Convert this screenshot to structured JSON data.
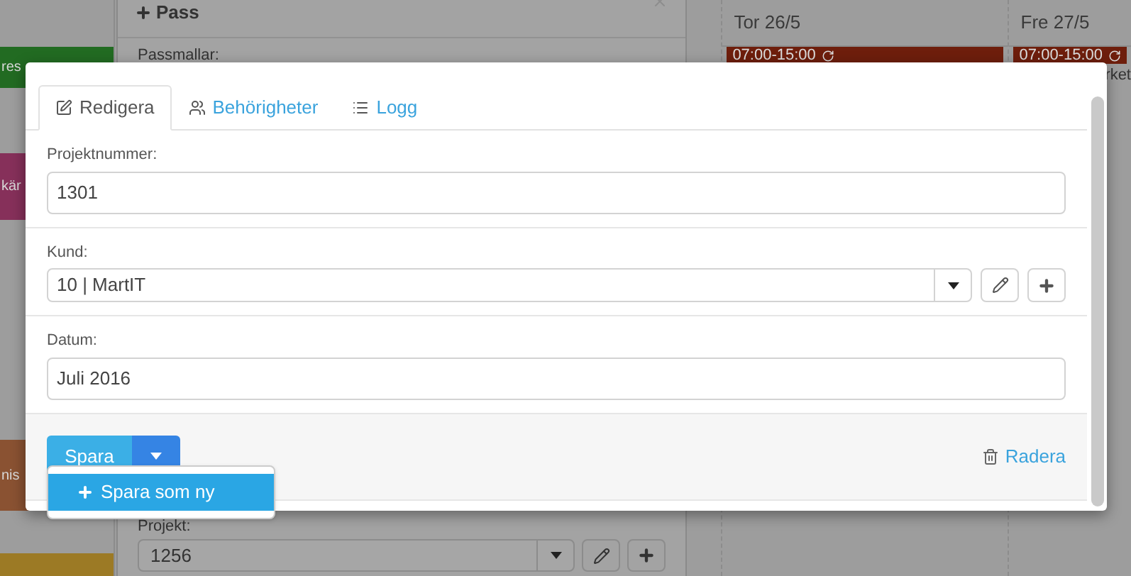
{
  "calendar": {
    "side_events": [
      {
        "text": "res",
        "color": "#226b22"
      },
      {
        "text": "kär",
        "color": "#86305a"
      },
      {
        "text": "nis",
        "color": "#8a5232"
      },
      {
        "color": "#9c7a25"
      }
    ],
    "days": [
      {
        "label": "Tor 26/5",
        "event": "07:00-15:00"
      },
      {
        "label": "Fre 27/5",
        "event": "07:00-15:00",
        "note": "rket"
      }
    ]
  },
  "pass_panel": {
    "title": "Pass",
    "templates_label": "Passmallar:",
    "project_label": "Projekt:",
    "project_value": "1256"
  },
  "dialog": {
    "tabs": [
      {
        "label": "Redigera",
        "selected": true
      },
      {
        "label": "Behörigheter",
        "selected": false
      },
      {
        "label": "Logg",
        "selected": false
      }
    ],
    "fields": [
      {
        "kind": "text",
        "label": "Projektnummer:",
        "value": "1301"
      },
      {
        "kind": "select",
        "label": "Kund:",
        "value": "10 | MartIT"
      },
      {
        "kind": "text",
        "label": "Datum:",
        "value": "Juli 2016"
      }
    ],
    "save_button": "Spara",
    "delete_link": "Radera",
    "save_menu": [
      {
        "label": "Spara som ny",
        "selected": true
      }
    ]
  }
}
